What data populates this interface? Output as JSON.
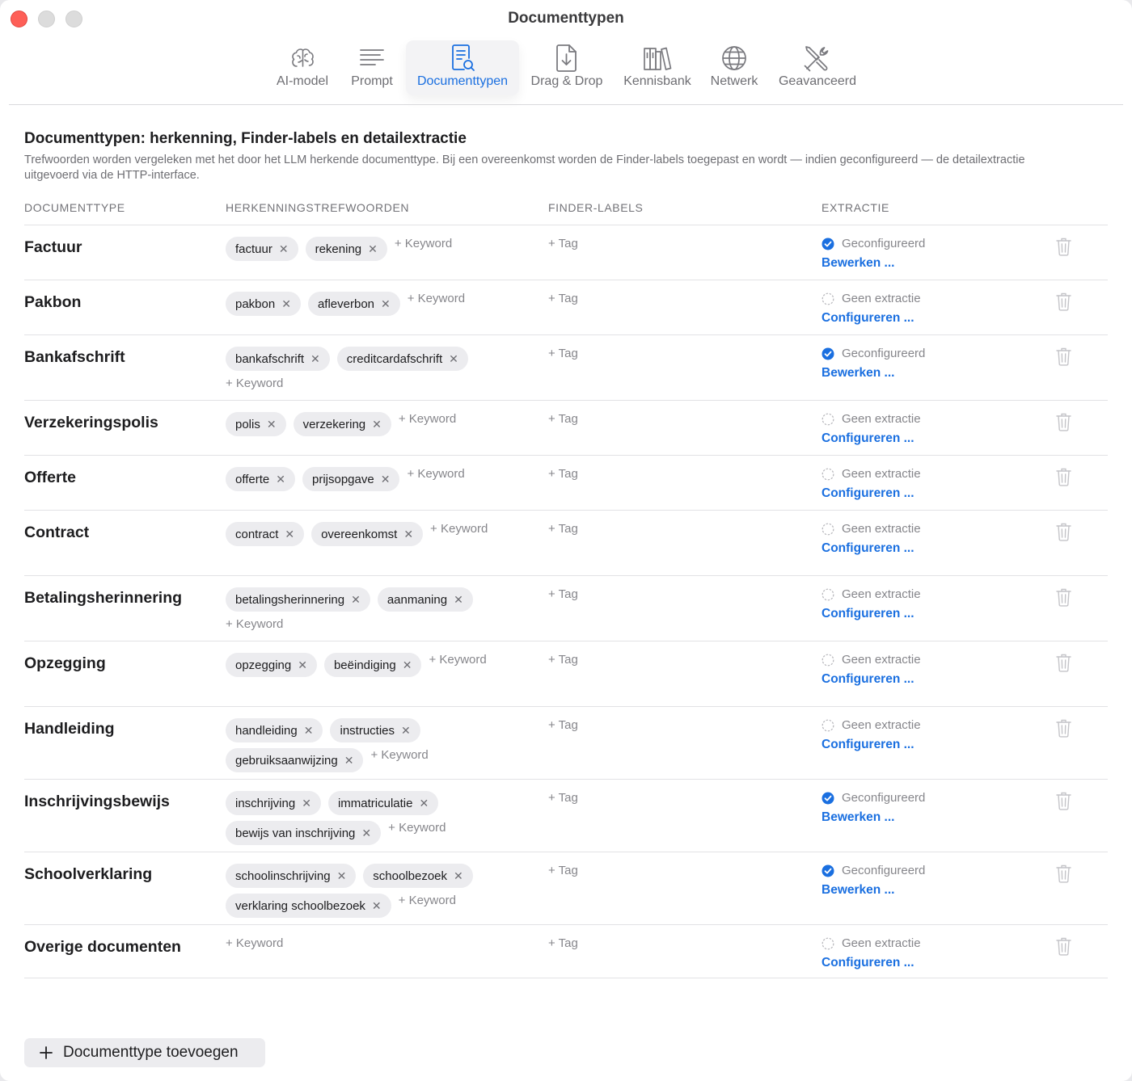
{
  "window": {
    "title": "Documenttypen"
  },
  "toolbar": {
    "tabs": [
      {
        "label": "AI-model",
        "icon": "brain-icon"
      },
      {
        "label": "Prompt",
        "icon": "text-lines-icon"
      },
      {
        "label": "Documenttypen",
        "icon": "document-search-icon",
        "active": true
      },
      {
        "label": "Drag & Drop",
        "icon": "document-download-icon"
      },
      {
        "label": "Kennisbank",
        "icon": "books-icon"
      },
      {
        "label": "Netwerk",
        "icon": "globe-icon"
      },
      {
        "label": "Geavanceerd",
        "icon": "tools-icon"
      }
    ]
  },
  "section": {
    "title": "Documenttypen: herkenning, Finder-labels en detailextractie",
    "description": "Trefwoorden worden vergeleken met het door het LLM herkende documenttype. Bij een overeenkomst worden de Finder-labels toegepast en wordt — indien geconfigureerd — de detailextractie uitgevoerd via de HTTP-interface."
  },
  "columns": {
    "type": "DOCUMENTTYPE",
    "keywords": "HERKENNINGSTREFWOORDEN",
    "labels": "FINDER-LABELS",
    "extraction": "EXTRACTIE"
  },
  "add_keyword_label": "+ Keyword",
  "add_tag_label": "+ Tag",
  "status_configured": "Geconfigureerd",
  "status_none": "Geen extractie",
  "action_edit": "Bewerken ...",
  "action_configure": "Configureren ...",
  "colors": {
    "accent": "#1a6fe0",
    "secondary_text": "#86868b",
    "chip_bg": "#ececef"
  },
  "document_types": [
    {
      "name": "Factuur",
      "keywords": [
        "factuur",
        "rekening"
      ],
      "configured": true
    },
    {
      "name": "Pakbon",
      "keywords": [
        "pakbon",
        "afleverbon"
      ],
      "configured": false
    },
    {
      "name": "Bankafschrift",
      "keywords": [
        "bankafschrift",
        "creditcardafschrift"
      ],
      "configured": true
    },
    {
      "name": "Verzekeringspolis",
      "keywords": [
        "polis",
        "verzekering"
      ],
      "configured": false
    },
    {
      "name": "Offerte",
      "keywords": [
        "offerte",
        "prijsopgave"
      ],
      "configured": false
    },
    {
      "name": "Contract",
      "keywords": [
        "contract",
        "overeenkomst"
      ],
      "configured": false
    },
    {
      "name": "Betalingsherinnering",
      "keywords": [
        "betalingsherinnering",
        "aanmaning"
      ],
      "configured": false
    },
    {
      "name": "Opzegging",
      "keywords": [
        "opzegging",
        "beëindiging"
      ],
      "configured": false
    },
    {
      "name": "Handleiding",
      "keywords": [
        "handleiding",
        "instructies",
        "gebruiksaanwijzing"
      ],
      "configured": false
    },
    {
      "name": "Inschrijvingsbewijs",
      "keywords": [
        "inschrijving",
        "immatriculatie",
        "bewijs van inschrijving"
      ],
      "configured": true
    },
    {
      "name": "Schoolverklaring",
      "keywords": [
        "schoolinschrijving",
        "schoolbezoek",
        "verklaring schoolbezoek"
      ],
      "configured": true
    },
    {
      "name": "Overige documenten",
      "keywords": [],
      "configured": false
    }
  ],
  "add_button": {
    "label": "Documenttype toevoegen",
    "icon": "plus-icon"
  }
}
